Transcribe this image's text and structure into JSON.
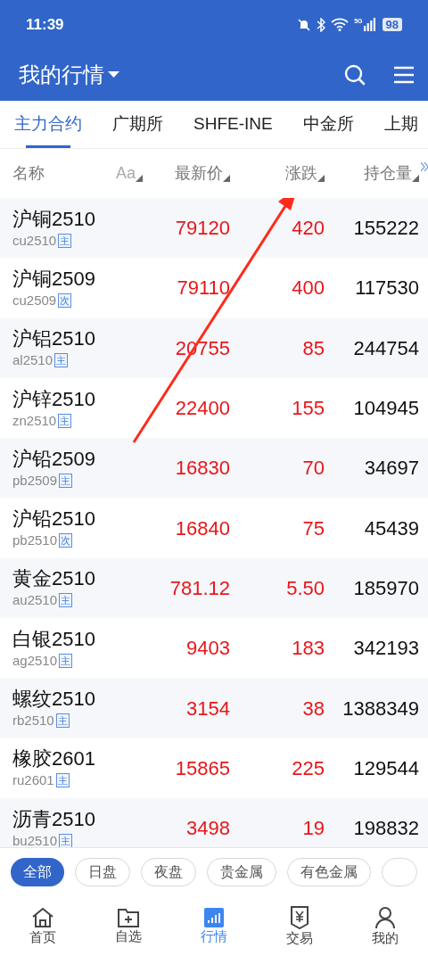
{
  "status_bar": {
    "time": "11:39",
    "network": "5G",
    "battery": "98"
  },
  "header": {
    "title": "我的行情"
  },
  "tabs": [
    {
      "label": "主力合约",
      "selected": true
    },
    {
      "label": "广期所",
      "selected": false
    },
    {
      "label": "SHFE-INE",
      "selected": false
    },
    {
      "label": "中金所",
      "selected": false
    },
    {
      "label": "上期",
      "selected": false
    }
  ],
  "table": {
    "columns": [
      "名称",
      "Aa",
      "最新价",
      "涨跌",
      "持仓量"
    ],
    "rows": [
      {
        "name": "沪铜2510",
        "code": "cu2510",
        "tag": "主",
        "price": "79120",
        "change": "420",
        "open_interest": "155222"
      },
      {
        "name": "沪铜2509",
        "code": "cu2509",
        "tag": "次",
        "price": "79110",
        "change": "400",
        "open_interest": "117530"
      },
      {
        "name": "沪铝2510",
        "code": "al2510",
        "tag": "主",
        "price": "20755",
        "change": "85",
        "open_interest": "244754"
      },
      {
        "name": "沪锌2510",
        "code": "zn2510",
        "tag": "主",
        "price": "22400",
        "change": "155",
        "open_interest": "104945"
      },
      {
        "name": "沪铅2509",
        "code": "pb2509",
        "tag": "主",
        "price": "16830",
        "change": "70",
        "open_interest": "34697"
      },
      {
        "name": "沪铅2510",
        "code": "pb2510",
        "tag": "次",
        "price": "16840",
        "change": "75",
        "open_interest": "45439"
      },
      {
        "name": "黄金2510",
        "code": "au2510",
        "tag": "主",
        "price": "781.12",
        "change": "5.50",
        "open_interest": "185970"
      },
      {
        "name": "白银2510",
        "code": "ag2510",
        "tag": "主",
        "price": "9403",
        "change": "183",
        "open_interest": "342193"
      },
      {
        "name": "螺纹2510",
        "code": "rb2510",
        "tag": "主",
        "price": "3154",
        "change": "38",
        "open_interest": "1388349"
      },
      {
        "name": "橡胶2601",
        "code": "ru2601",
        "tag": "主",
        "price": "15865",
        "change": "225",
        "open_interest": "129544"
      },
      {
        "name": "沥青2510",
        "code": "bu2510",
        "tag": "主",
        "price": "3498",
        "change": "19",
        "open_interest": "198832"
      }
    ]
  },
  "filters": [
    {
      "label": "全部",
      "selected": true
    },
    {
      "label": "日盘",
      "selected": false
    },
    {
      "label": "夜盘",
      "selected": false
    },
    {
      "label": "贵金属",
      "selected": false
    },
    {
      "label": "有色金属",
      "selected": false
    }
  ],
  "bottom_nav": [
    {
      "label": "首页",
      "selected": false
    },
    {
      "label": "自选",
      "selected": false
    },
    {
      "label": "行情",
      "selected": true
    },
    {
      "label": "交易",
      "selected": false
    },
    {
      "label": "我的",
      "selected": false
    }
  ]
}
